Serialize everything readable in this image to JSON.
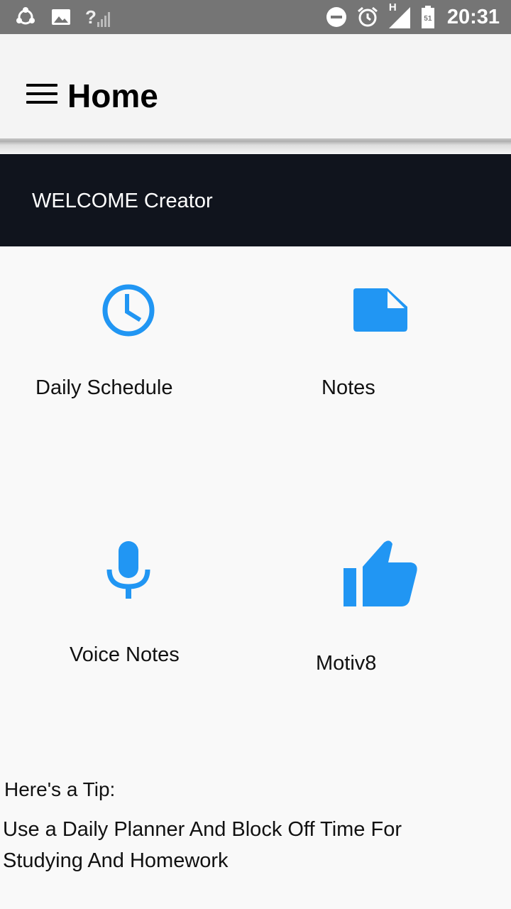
{
  "status_bar": {
    "time": "20:31",
    "signal_prefix": "?",
    "network_type": "H",
    "battery_level": "51",
    "icons": [
      "sync-icon",
      "gallery-icon",
      "no-signal-icon",
      "do-not-disturb-icon",
      "alarm-icon",
      "cell-signal-icon",
      "battery-icon"
    ]
  },
  "app_bar": {
    "title": "Home",
    "menu_icon": "hamburger-menu-icon"
  },
  "welcome": {
    "text": "WELCOME Creator"
  },
  "tiles": [
    {
      "label": "Daily Schedule",
      "icon": "clock-icon"
    },
    {
      "label": "Notes",
      "icon": "note-icon"
    },
    {
      "label": "Voice Notes",
      "icon": "microphone-icon"
    },
    {
      "label": "Motiv8",
      "icon": "thumbs-up-icon"
    }
  ],
  "tip": {
    "title": "Here's a Tip:",
    "body": "Use a Daily Planner And Block Off Time For Studying And Homework"
  },
  "colors": {
    "accent": "#2196F3",
    "welcome_background": "#10141D",
    "status_bar": "#757575",
    "app_bar": "#F4F4F4"
  }
}
